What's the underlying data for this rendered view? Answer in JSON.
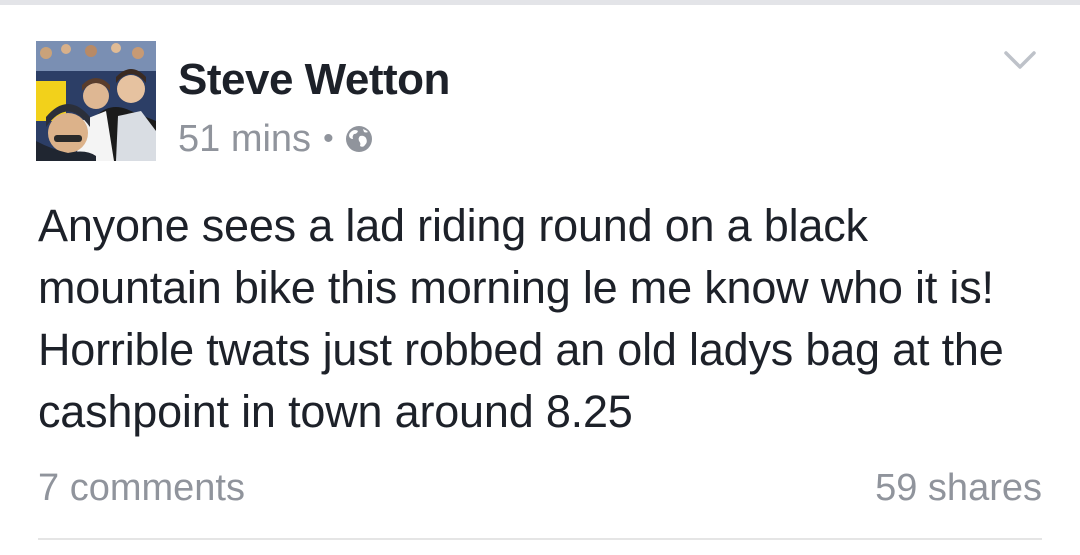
{
  "post": {
    "author": "Steve Wetton",
    "time": "51 mins",
    "separator": "•",
    "privacy_icon": "globe-icon",
    "options_icon": "chevron-down-icon",
    "text": "Anyone sees a lad riding round on a black mountain bike this morning le me know who it is! Horrible twats just robbed an old ladys bag at the cashpoint in town around 8.25",
    "comments": "7 comments",
    "shares": "59 shares"
  },
  "colors": {
    "name": "#1d2129",
    "meta": "#90949c",
    "divider": "#e5e5e5"
  }
}
